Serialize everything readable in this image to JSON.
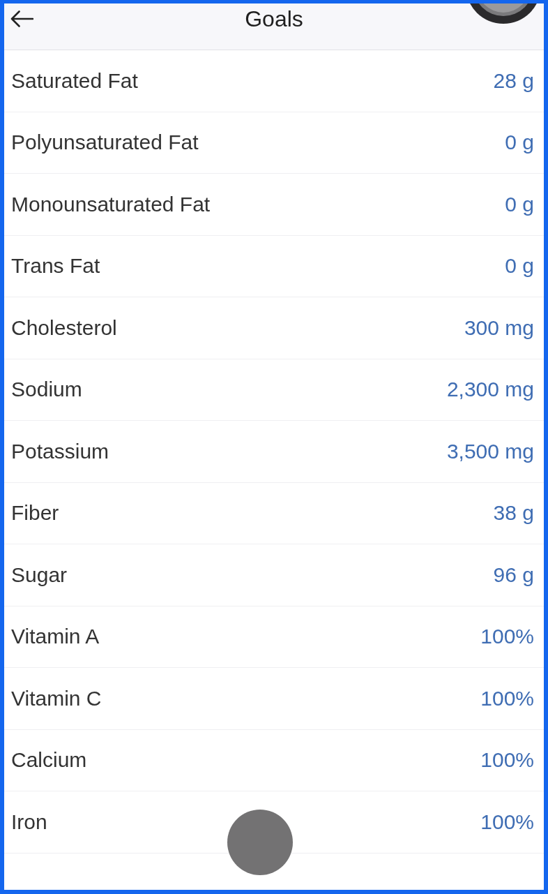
{
  "header": {
    "title": "Goals"
  },
  "goals": [
    {
      "name": "Saturated Fat",
      "value": "28 g"
    },
    {
      "name": "Polyunsaturated Fat",
      "value": "0 g"
    },
    {
      "name": "Monounsaturated Fat",
      "value": "0 g"
    },
    {
      "name": "Trans Fat",
      "value": "0 g"
    },
    {
      "name": "Cholesterol",
      "value": "300 mg"
    },
    {
      "name": "Sodium",
      "value": "2,300 mg"
    },
    {
      "name": "Potassium",
      "value": "3,500 mg"
    },
    {
      "name": "Fiber",
      "value": "38 g"
    },
    {
      "name": "Sugar",
      "value": "96 g"
    },
    {
      "name": "Vitamin A",
      "value": "100%"
    },
    {
      "name": "Vitamin C",
      "value": "100%"
    },
    {
      "name": "Calcium",
      "value": "100%"
    },
    {
      "name": "Iron",
      "value": "100%"
    }
  ]
}
